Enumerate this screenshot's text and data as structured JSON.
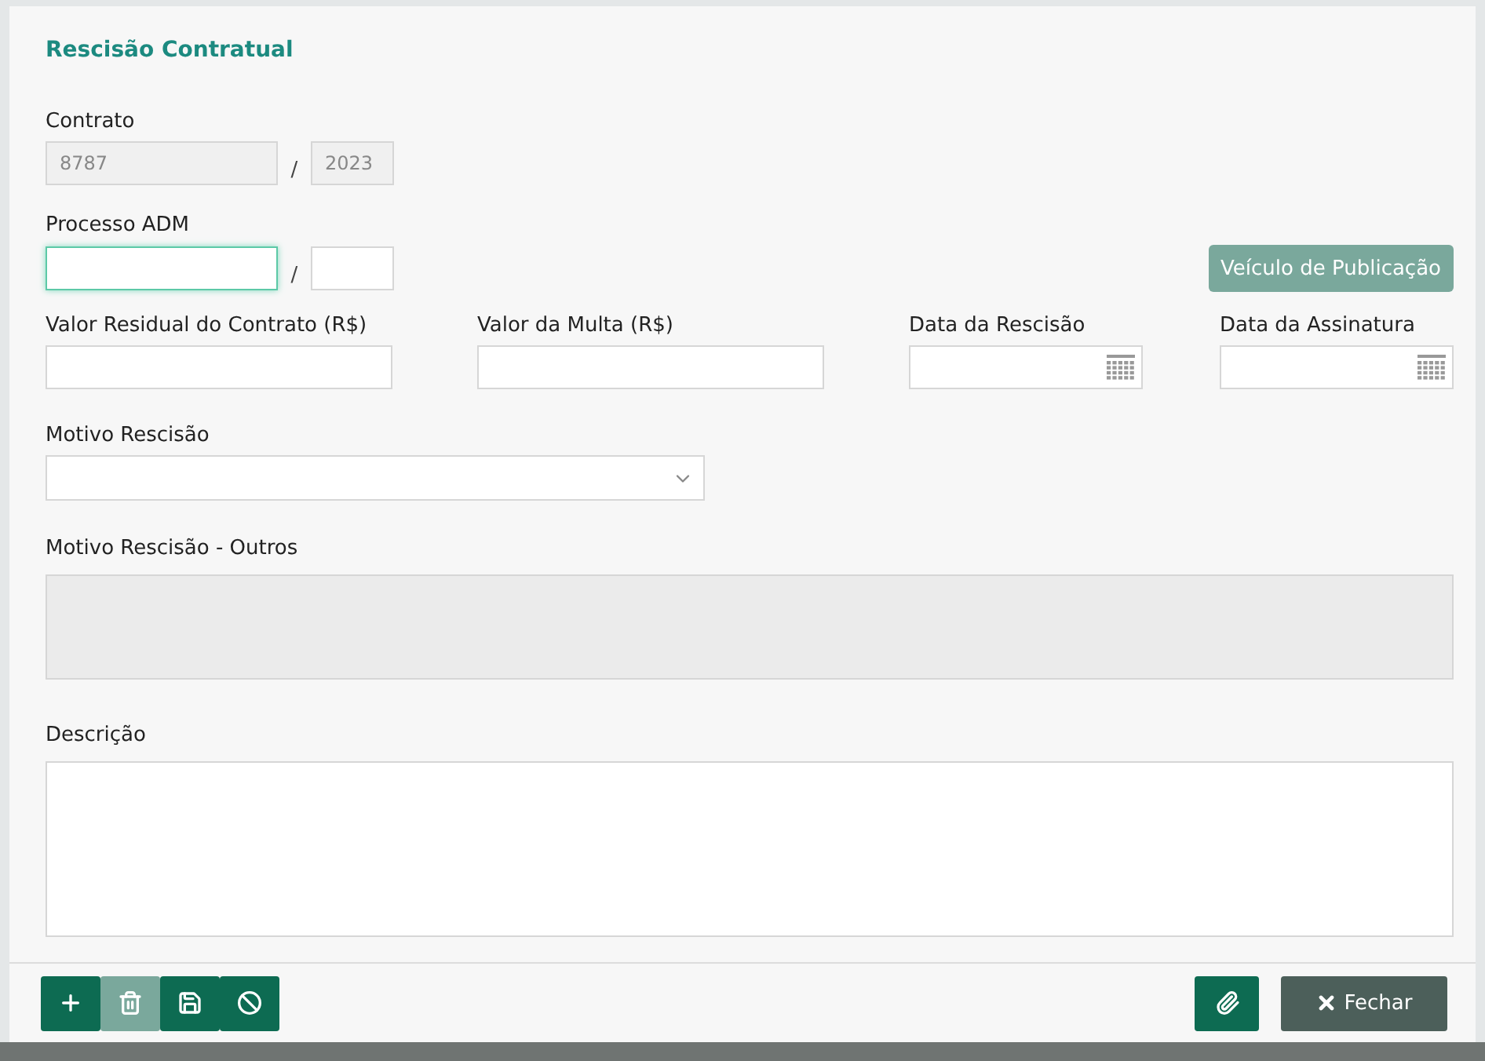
{
  "title": "Rescisão Contratual",
  "contrato": {
    "label": "Contrato",
    "number": "8787",
    "separator": "/",
    "year": "2023",
    "disabled": true
  },
  "processo": {
    "label": "Processo ADM",
    "separator": "/",
    "focused": true
  },
  "publication_button": {
    "label": "Veículo de Publicação",
    "disabled": true
  },
  "fields": [
    {
      "label": "Valor Residual do Contrato (R$)",
      "kind": "text"
    },
    {
      "label": "Valor da Multa (R$)",
      "kind": "text"
    },
    {
      "label": "Data da Rescisão",
      "kind": "date"
    },
    {
      "label": "Data da Assinatura",
      "kind": "date"
    }
  ],
  "motivo": {
    "label": "Motivo Rescisão"
  },
  "motivo_outros": {
    "label": "Motivo Rescisão - Outros",
    "disabled": true
  },
  "descricao": {
    "label": "Descrição",
    "disabled": false
  },
  "toolbar": [
    {
      "kind": "add",
      "disabled": false
    },
    {
      "kind": "delete",
      "disabled": true
    },
    {
      "kind": "save",
      "disabled": false
    },
    {
      "kind": "cancel",
      "disabled": false
    }
  ],
  "attach_button": {
    "disabled": false
  },
  "close_button": {
    "label": "Fechar"
  }
}
